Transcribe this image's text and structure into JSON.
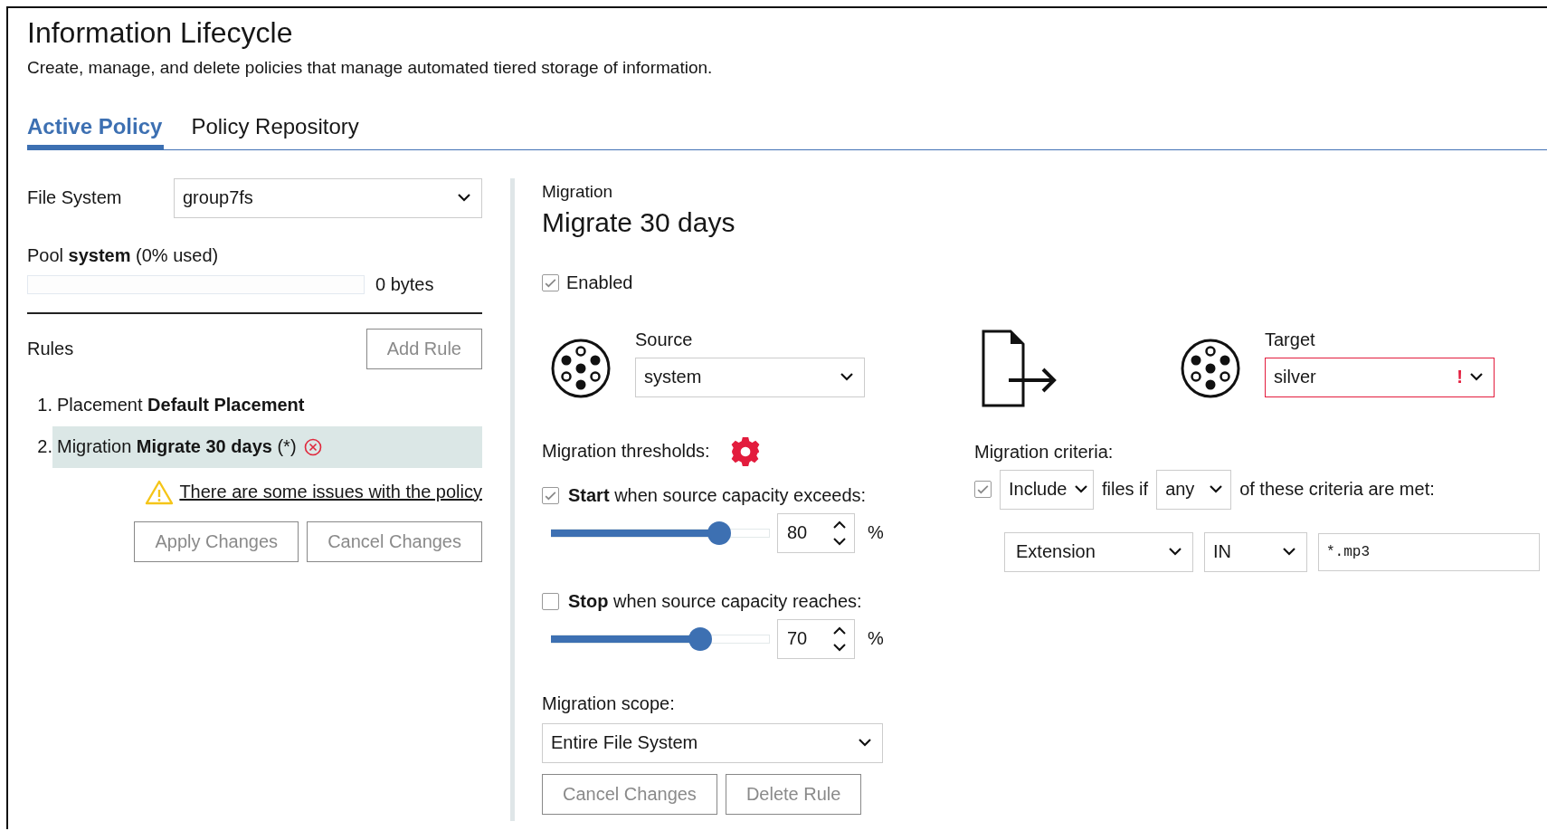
{
  "header": {
    "title": "Information Lifecycle",
    "subtitle": "Create, manage, and delete policies that manage automated tiered storage of information."
  },
  "tabs": [
    {
      "label": "Active Policy",
      "selected": true
    },
    {
      "label": "Policy Repository",
      "selected": false
    }
  ],
  "file_system": {
    "label": "File System",
    "value": "group7fs"
  },
  "pool": {
    "label": "Pool **system** (0% used)",
    "level": 0,
    "reading": "0 bytes"
  },
  "rules": {
    "label": "Rules",
    "add_button": "Add Rule",
    "items": [
      {
        "number": "1.",
        "text": "Placement **Default Placement**",
        "selected": false,
        "error": false
      },
      {
        "number": "2.",
        "text": "Migration **Migrate 30 days** (*)",
        "selected": true,
        "error": true
      }
    ]
  },
  "warning": "There are some issues with the policy",
  "buttons": [
    "Apply Changes",
    "Cancel Changes"
  ],
  "rule_editor": {
    "type_label": "Migration",
    "name": "Migrate 30 days",
    "enabled": {
      "label": "Enabled",
      "checked": true
    },
    "source": {
      "label": "Source",
      "value": "system"
    },
    "target": {
      "label": "Target",
      "value": "silver",
      "error": true,
      "error_mark": "!"
    },
    "thresholds": {
      "label": "Migration thresholds:",
      "error": true,
      "items": [
        {
          "text": "**Start** when source capacity exceeds:",
          "checked": true,
          "level": 0.77,
          "value": "80",
          "unit": "%"
        },
        {
          "text": "**Stop** when source capacity reaches:",
          "checked": false,
          "level": 0.68,
          "value": "70",
          "unit": "%"
        }
      ]
    },
    "scope": {
      "label": "Migration scope:",
      "value": "Entire File System"
    },
    "buttons": [
      "Cancel Changes",
      "Delete Rule"
    ],
    "criteria": {
      "label": "Migration criteria:",
      "checked": true,
      "mode": "Include",
      "files_if": "files if",
      "quantifier": "any",
      "tail": "of these criteria are met:",
      "rows": [
        {
          "attribute": "Extension",
          "operator": "IN",
          "value": "*.mp3"
        }
      ]
    }
  }
}
